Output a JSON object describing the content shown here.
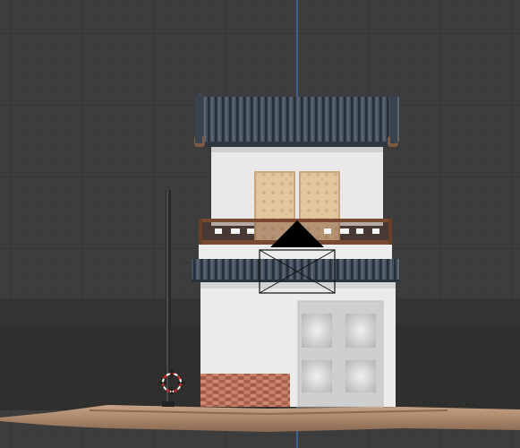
{
  "viewport": {
    "name": "3D viewport",
    "background_color": "#3d3d3d",
    "grid_color": "#353535",
    "axis_color": "#3f6fb3"
  },
  "scene": {
    "objects": [
      "ground-plane",
      "house",
      "pole",
      "camera",
      "3d-cursor"
    ],
    "colors": {
      "roof_tile": "#46505c",
      "wall": "#e9e9e9",
      "window_panel": "#e2c6a0",
      "railing": "#7a4a30",
      "brick": "#c07a66",
      "door": "#cfcfcf",
      "pole": "#2b2b2b",
      "ground": "#b99577",
      "backdrop": "#2f2f2d"
    }
  }
}
